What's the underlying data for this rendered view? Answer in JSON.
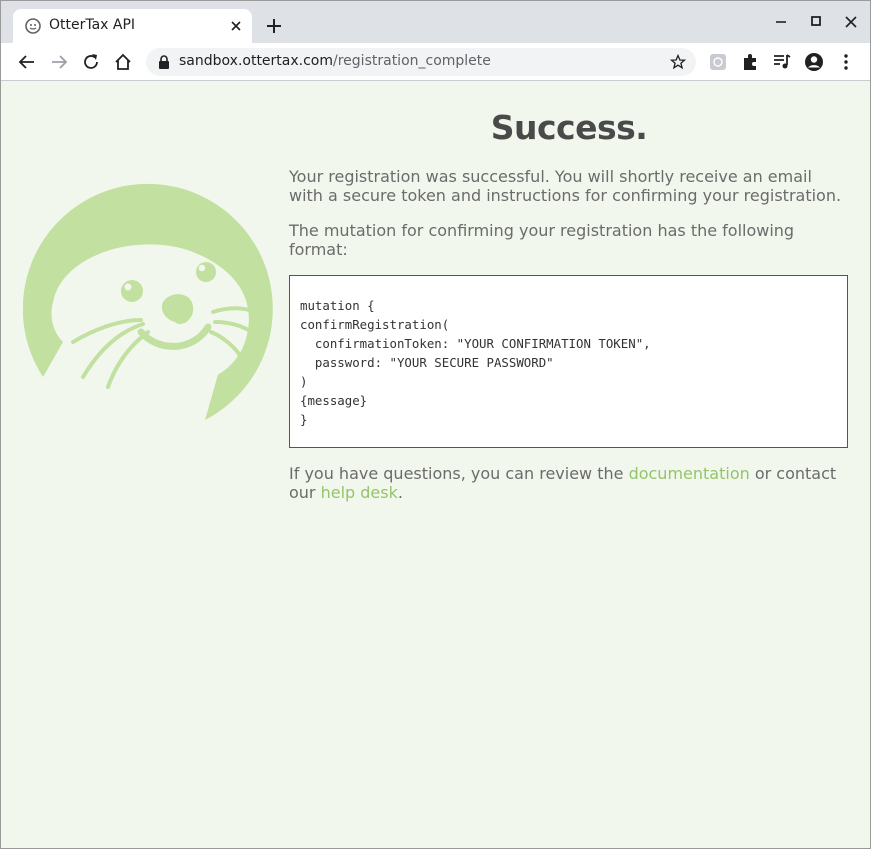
{
  "browser": {
    "tab_title": "OtterTax API",
    "url_host": "sandbox.ottertax.com",
    "url_path": "/registration_complete"
  },
  "page": {
    "heading": "Success.",
    "intro": "Your registration was successful. You will shortly receive an email with a secure token and instructions for confirming your registration.",
    "format_text": "The mutation for confirming your registration has the following format:",
    "code_lines": [
      "mutation {",
      "confirmRegistration(",
      "  confirmationToken: \"YOUR CONFIRMATION TOKEN\",",
      "  password: \"YOUR SECURE PASSWORD\"",
      ")",
      "{message}",
      "}"
    ],
    "footer_before": "If you have questions, you can review the ",
    "footer_link1": "documentation",
    "footer_middle": " or contact our ",
    "footer_link2": "help desk",
    "footer_after": "."
  },
  "colors": {
    "accent": "#94c46a",
    "logo": "#c2e0a0",
    "page_bg": "#f2f7ed"
  },
  "icons": [
    "otter-favicon",
    "close-icon",
    "plus-icon",
    "minimize-icon",
    "maximize-icon",
    "window-close-icon",
    "back-icon",
    "forward-icon",
    "reload-icon",
    "home-icon",
    "lock-icon",
    "star-icon",
    "extension-icon",
    "puzzle-icon",
    "media-icon",
    "profile-icon",
    "menu-icon",
    "otter-logo"
  ]
}
